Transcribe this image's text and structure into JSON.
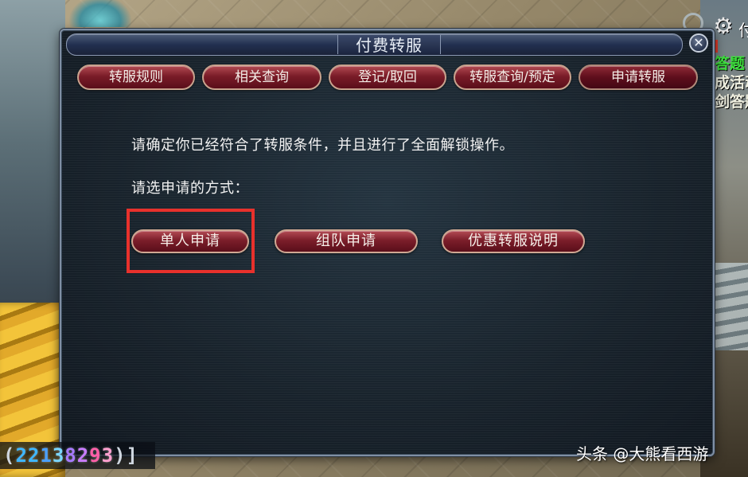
{
  "dialog": {
    "title": "付费转服",
    "close_glyph": "✕",
    "tabs": [
      {
        "label": "转服规则",
        "active": false
      },
      {
        "label": "相关查询",
        "active": false
      },
      {
        "label": "登记/取回",
        "active": false
      },
      {
        "label": "转服查询/预定",
        "active": false
      },
      {
        "label": "申请转服",
        "active": true
      }
    ],
    "message_confirm": "请确定你已经符合了转服条件，并且进行了全面解锁操作。",
    "message_choose": "请选申请的方式：",
    "options": [
      {
        "label": "单人申请",
        "highlighted": true
      },
      {
        "label": "组队申请",
        "highlighted": false
      },
      {
        "label": "优惠转服说明",
        "highlighted": false
      }
    ],
    "highlight_color": "#e8312c"
  },
  "hud": {
    "gear_icon": "gear-icon",
    "right_lines": [
      "答题",
      "成活动",
      "剑答题"
    ],
    "right_partial": "付"
  },
  "counter": {
    "open": "(",
    "digits": [
      "2",
      "2",
      "1",
      "3",
      "8",
      "2",
      "9",
      "3"
    ],
    "digit_colors": [
      "#3fb6ff",
      "#3fb6ff",
      "#4aa0ff",
      "#7ad6ff",
      "#a77aff",
      "#c87cff",
      "#ff5fa8",
      "#ff9fcf"
    ],
    "close": ")]"
  },
  "watermark": "头条 @大熊看西游"
}
